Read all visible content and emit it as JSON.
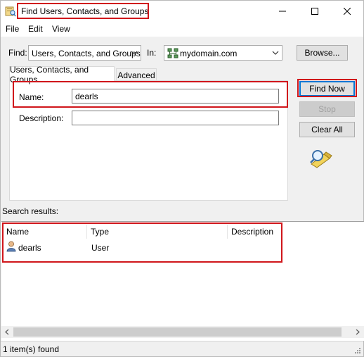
{
  "window": {
    "title": "Find Users, Contacts, and Groups"
  },
  "menu": {
    "items": [
      "File",
      "Edit",
      "View"
    ]
  },
  "find_bar": {
    "find_label": "Find:",
    "find_value": "Users, Contacts, and Groups",
    "in_label": "In:",
    "in_value": "mydomain.com",
    "browse_label": "Browse..."
  },
  "tabs": [
    {
      "label": "Users, Contacts, and Groups",
      "active": true
    },
    {
      "label": "Advanced",
      "active": false
    }
  ],
  "form": {
    "name_label": "Name:",
    "name_value": "dearls",
    "description_label": "Description:",
    "description_value": ""
  },
  "buttons": {
    "find_now": "Find Now",
    "stop": "Stop",
    "clear_all": "Clear All"
  },
  "results": {
    "label": "Search results:",
    "columns": [
      "Name",
      "Type",
      "Description"
    ],
    "rows": [
      {
        "name": "dearls",
        "type": "User",
        "description": ""
      }
    ]
  },
  "status": {
    "text": "1 item(s) found"
  },
  "colors": {
    "highlight": "#d0161b",
    "accent": "#0078d7"
  }
}
